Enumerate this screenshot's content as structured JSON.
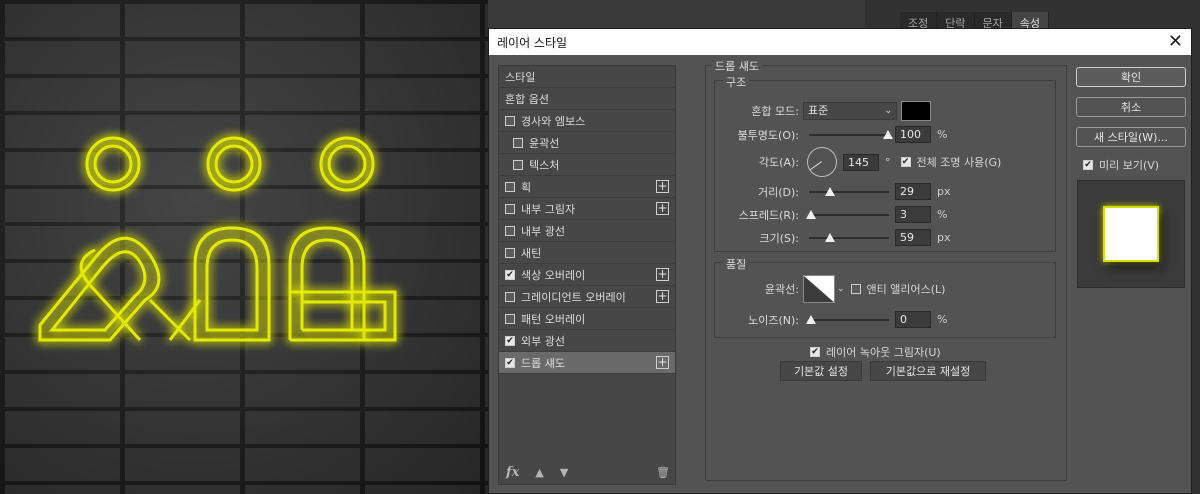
{
  "dialog": {
    "title": "레이어 스타일",
    "close": "✕"
  },
  "background_tabs": [
    "조정",
    "단락",
    "문자",
    "속성"
  ],
  "style_list": {
    "items": [
      {
        "label": "스타일",
        "checkbox": false,
        "checked": false,
        "plus": false,
        "indent": false,
        "selected": false
      },
      {
        "label": "혼합 옵션",
        "checkbox": false,
        "checked": false,
        "plus": false,
        "indent": false,
        "selected": false
      },
      {
        "label": "경사와 엠보스",
        "checkbox": true,
        "checked": false,
        "plus": false,
        "indent": false,
        "selected": false
      },
      {
        "label": "윤곽선",
        "checkbox": true,
        "checked": false,
        "plus": false,
        "indent": true,
        "selected": false
      },
      {
        "label": "텍스처",
        "checkbox": true,
        "checked": false,
        "plus": false,
        "indent": true,
        "selected": false
      },
      {
        "label": "획",
        "checkbox": true,
        "checked": false,
        "plus": true,
        "indent": false,
        "selected": false
      },
      {
        "label": "내부 그림자",
        "checkbox": true,
        "checked": false,
        "plus": true,
        "indent": false,
        "selected": false
      },
      {
        "label": "내부 광선",
        "checkbox": true,
        "checked": false,
        "plus": false,
        "indent": false,
        "selected": false
      },
      {
        "label": "새틴",
        "checkbox": true,
        "checked": false,
        "plus": false,
        "indent": false,
        "selected": false
      },
      {
        "label": "색상 오버레이",
        "checkbox": true,
        "checked": true,
        "plus": true,
        "indent": false,
        "selected": false
      },
      {
        "label": "그레이디언트 오버레이",
        "checkbox": true,
        "checked": false,
        "plus": true,
        "indent": false,
        "selected": false
      },
      {
        "label": "패턴 오버레이",
        "checkbox": true,
        "checked": false,
        "plus": false,
        "indent": false,
        "selected": false
      },
      {
        "label": "외부 광선",
        "checkbox": true,
        "checked": true,
        "plus": false,
        "indent": false,
        "selected": false
      },
      {
        "label": "드롭 섀도",
        "checkbox": true,
        "checked": true,
        "plus": true,
        "indent": false,
        "selected": true
      }
    ],
    "footer": {
      "fx": "fx",
      "up": "▲",
      "down": "▼",
      "trash": "🗑"
    }
  },
  "drop_shadow": {
    "section_title": "드롭 섀도",
    "structure_title": "구조",
    "blend_mode_label": "혼합 모드:",
    "blend_mode_value": "표준",
    "shadow_color": "#000000",
    "opacity_label": "불투명도(O):",
    "opacity_value": "100",
    "opacity_unit": "%",
    "angle_label": "각도(A):",
    "angle_value": "145",
    "angle_unit": "°",
    "global_light_label": "전체 조명 사용(G)",
    "global_light_checked": true,
    "distance_label": "거리(D):",
    "distance_value": "29",
    "distance_unit": "px",
    "spread_label": "스프레드(R):",
    "spread_value": "3",
    "spread_unit": "%",
    "size_label": "크기(S):",
    "size_value": "59",
    "size_unit": "px",
    "quality_title": "품질",
    "contour_label": "윤곽선:",
    "antialias_label": "앤티 앨리어스(L)",
    "antialias_checked": false,
    "noise_label": "노이즈(N):",
    "noise_value": "0",
    "noise_unit": "%",
    "knockout_label": "레이어 녹아웃 그림자(U)",
    "knockout_checked": true,
    "set_default_button": "기본값 설정",
    "reset_default_button": "기본값으로 재설정"
  },
  "buttons": {
    "ok": "확인",
    "cancel": "취소",
    "new_style": "새 스타일(W)...",
    "preview_label": "미리 보기(V)",
    "preview_checked": true
  },
  "colors": {
    "neon": "#e3ea00",
    "dialog_bg": "#535353",
    "list_bg": "#474747"
  }
}
